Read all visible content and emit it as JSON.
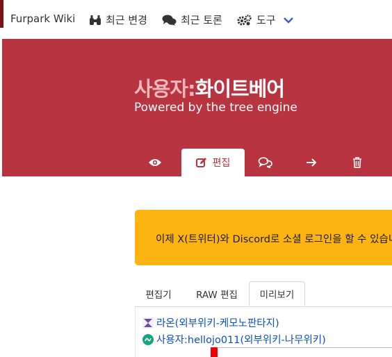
{
  "nav": {
    "brand": "Furpark Wiki",
    "recent_changes": "최근 변경",
    "recent_discuss": "최근 토론",
    "tools": "도구"
  },
  "header": {
    "namespace": "사용자:",
    "name": "화이트베어",
    "subtitle": "Powered by the tree engine"
  },
  "page_tabs": {
    "edit_label": "편집"
  },
  "notice": {
    "text": "이제 X(트위터)와 Discord로 소셜 로그인을 할 수 있습니"
  },
  "editor_tabs": [
    "편집기",
    "RAW 편집",
    "미리보기"
  ],
  "preview_links": [
    "라온(외부위키-케모노판타지)",
    "사용자:hellojo011(외부위키-나무위키)"
  ],
  "colors": {
    "header_bg": "#b73440",
    "notice_bg": "#fbb411",
    "link": "#0a4fc6"
  }
}
